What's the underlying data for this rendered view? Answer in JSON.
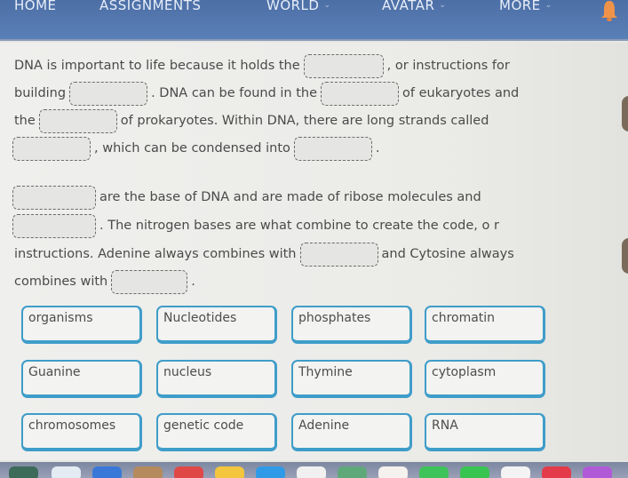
{
  "nav": {
    "items": [
      {
        "label": "HOME",
        "has_dropdown": false
      },
      {
        "label": "ASSIGNMENTS",
        "has_dropdown": false
      },
      {
        "label": "WORLD",
        "has_dropdown": true
      },
      {
        "label": "AVATAR",
        "has_dropdown": true
      },
      {
        "label": "MORE",
        "has_dropdown": true
      }
    ],
    "notification_icon": "bell-icon",
    "accent_color": "#5677b0",
    "bell_color": "#f0934a"
  },
  "passage": {
    "lines": [
      [
        "DNA is important to life because it holds the",
        "BLANK",
        ", or instructions for"
      ],
      [
        "building",
        "BLANK",
        ". DNA can be found in the",
        "BLANK",
        "of eukaryotes and"
      ],
      [
        "the",
        "BLANK",
        "of prokaryotes. Within DNA, there are long strands called"
      ],
      [
        "BLANK",
        ", which can be condensed into",
        "BLANK",
        "."
      ],
      [
        "BLANK",
        "are the base of DNA and are made of ribose molecules and"
      ],
      [
        "BLANK",
        ". The nitrogen bases are what combine to create the code, o r"
      ],
      [
        "instructions. Adenine always combines with",
        "BLANK",
        "and Cytosine always"
      ],
      [
        "combines with",
        "BLANK",
        "."
      ]
    ],
    "t": {
      "l0a": "DNA is important to life because it holds the",
      "l0b": ", or instructions for",
      "l1a": "building",
      "l1b": ". DNA can be found in the",
      "l1c": "of eukaryotes and",
      "l2a": "the",
      "l2b": "of prokaryotes. Within DNA, there are long strands called",
      "l3a": ", which can be condensed into",
      "l3b": ".",
      "l4a": "are the base of DNA and are made of ribose molecules and",
      "l5a": ". The nitrogen bases are what combine to create the code, o r",
      "l6a": "instructions. Adenine always combines with",
      "l6b": "and Cytosine always",
      "l7a": "combines with",
      "l7b": "."
    }
  },
  "word_bank": {
    "rows": [
      [
        "organisms",
        "Nucleotides",
        "phosphates",
        "chromatin"
      ],
      [
        "Guanine",
        "nucleus",
        "Thymine",
        "cytoplasm"
      ],
      [
        "chromosomes",
        "genetic code",
        "Adenine",
        "RNA"
      ]
    ],
    "chip_border_color": "#3f9dc9"
  }
}
